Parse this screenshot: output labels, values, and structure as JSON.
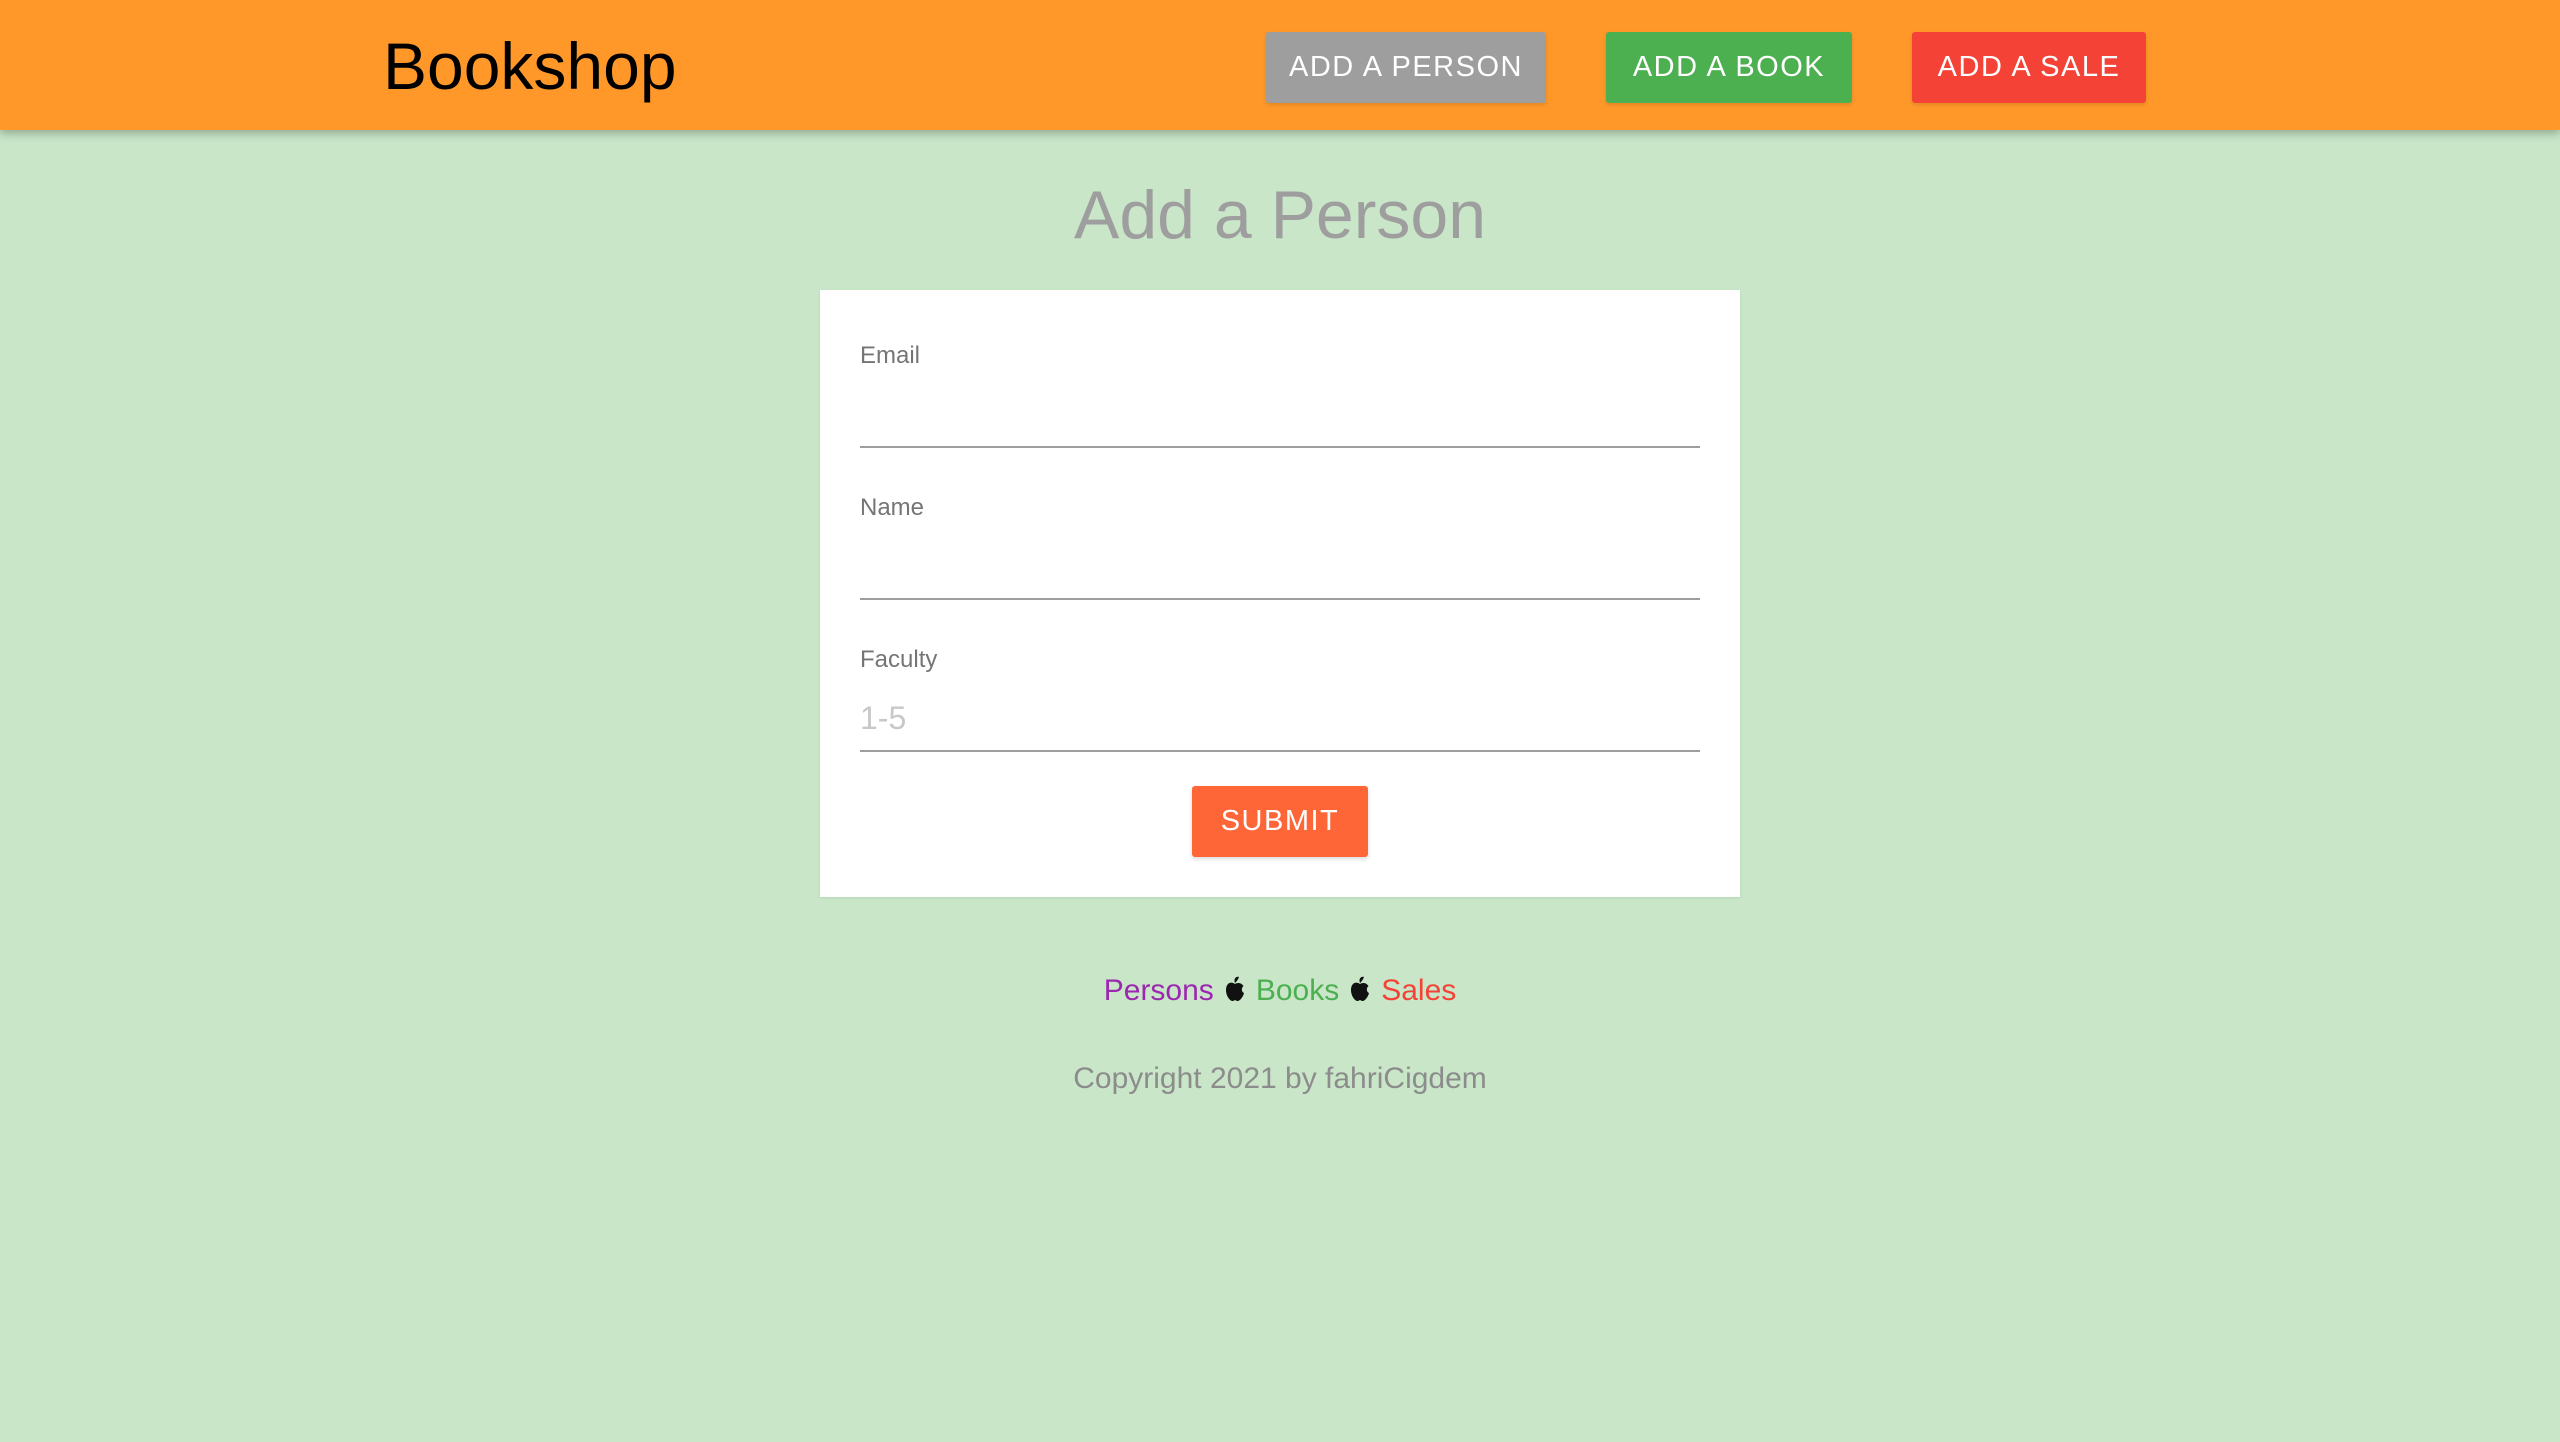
{
  "header": {
    "brand": "Bookshop",
    "buttons": {
      "add_person": "ADD A PERSON",
      "add_book": "ADD A BOOK",
      "add_sale": "ADD A SALE"
    }
  },
  "main": {
    "title": "Add a Person",
    "form": {
      "email": {
        "label": "Email",
        "value": "",
        "placeholder": ""
      },
      "name": {
        "label": "Name",
        "value": "",
        "placeholder": ""
      },
      "faculty": {
        "label": "Faculty",
        "value": "",
        "placeholder": "1-5"
      },
      "submit_label": "SUBMIT"
    }
  },
  "footer": {
    "links": {
      "persons": "Persons",
      "books": "Books",
      "sales": "Sales"
    },
    "separator_icon": "apple-icon",
    "copyright": "Copyright 2021 by fahriCigdem"
  },
  "colors": {
    "navbar": "#ff9829",
    "background": "#c9e6c9",
    "add_person_button": "#9e9e9e",
    "add_book_button": "#4caf50",
    "add_sale_button": "#f44336",
    "submit_button": "#ff6637",
    "persons_link": "#9c27b0",
    "books_link": "#4caf50",
    "sales_link": "#f44336"
  }
}
